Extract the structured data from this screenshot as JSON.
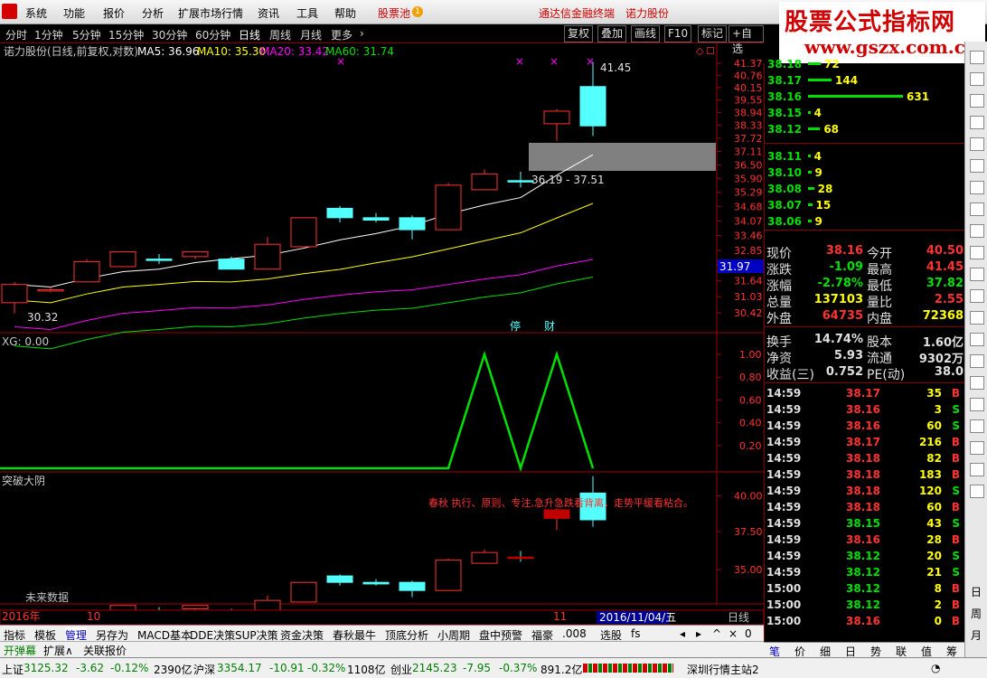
{
  "menubar": {
    "items": [
      "系统",
      "功能",
      "报价",
      "分析",
      "扩展市场行情",
      "资讯",
      "工具",
      "帮助"
    ],
    "stock_pool": "股票池",
    "stock_pool_badge": "1",
    "promo": "通达信金融终端",
    "stock_name": "诺力股份"
  },
  "banner": {
    "line1": "股票公式指标网",
    "line2": "www.gszx.com.cn"
  },
  "periods": [
    "分时",
    "1分钟",
    "5分钟",
    "15分钟",
    "30分钟",
    "60分钟",
    "日线",
    "周线",
    "月线",
    "更多"
  ],
  "period_active": "日线",
  "tool_buttons": [
    "复权",
    "叠加",
    "画线",
    "F10",
    "标记",
    "+自选"
  ],
  "main_chart": {
    "title": "诺力股份(日线,前复权,对数)",
    "ma5": "MA5: 36.96",
    "ma10": "MA10: 35.30",
    "ma20": "MA20: 33.42",
    "ma60": "MA60: 31.74",
    "price_axis": [
      "41.37",
      "40.76",
      "40.15",
      "39.55",
      "38.94",
      "38.33",
      "37.72",
      "37.11",
      "36.50",
      "35.90",
      "35.29",
      "34.68",
      "34.07",
      "33.46",
      "32.85",
      "32.25",
      "31.64",
      "31.03",
      "30.42"
    ],
    "current_price_tag": "31.97",
    "high_label": "41.45",
    "low_label": "30.32",
    "range_label": "36.19 - 37.51",
    "markers": [
      "停",
      "财"
    ],
    "candles": [
      {
        "o": 30.8,
        "c": 31.5,
        "h": 31.6,
        "l": 30.4,
        "up": true
      },
      {
        "o": 31.3,
        "c": 31.3,
        "h": 31.4,
        "l": 31.2,
        "up": true
      },
      {
        "o": 31.6,
        "c": 32.4,
        "h": 32.5,
        "l": 31.6,
        "up": true
      },
      {
        "o": 32.2,
        "c": 32.8,
        "h": 32.8,
        "l": 32.2,
        "up": true
      },
      {
        "o": 32.5,
        "c": 32.5,
        "h": 32.7,
        "l": 32.3,
        "up": false
      },
      {
        "o": 32.6,
        "c": 32.8,
        "h": 32.8,
        "l": 32.5,
        "up": true
      },
      {
        "o": 32.5,
        "c": 32.1,
        "h": 32.6,
        "l": 32.1,
        "up": false
      },
      {
        "o": 32.1,
        "c": 33.1,
        "h": 33.4,
        "l": 32.1,
        "up": true
      },
      {
        "o": 33.0,
        "c": 34.2,
        "h": 34.2,
        "l": 33.0,
        "up": true
      },
      {
        "o": 34.6,
        "c": 34.2,
        "h": 34.7,
        "l": 34.0,
        "up": false
      },
      {
        "o": 34.2,
        "c": 34.1,
        "h": 34.4,
        "l": 34.0,
        "up": false
      },
      {
        "o": 34.2,
        "c": 33.7,
        "h": 34.3,
        "l": 33.3,
        "up": false
      },
      {
        "o": 33.7,
        "c": 35.6,
        "h": 35.7,
        "l": 33.7,
        "up": true
      },
      {
        "o": 35.4,
        "c": 36.1,
        "h": 36.3,
        "l": 35.4,
        "up": true
      },
      {
        "o": 35.8,
        "c": 35.8,
        "h": 36.2,
        "l": 35.5,
        "up": false
      },
      {
        "o": 38.4,
        "c": 39.0,
        "h": 39.1,
        "l": 37.6,
        "up": true
      },
      {
        "o": 40.2,
        "c": 38.3,
        "h": 41.45,
        "l": 37.82,
        "up": false
      }
    ]
  },
  "xg_panel": {
    "title": "XG: 0.00",
    "axis": [
      "1.00",
      "0.80",
      "0.60",
      "0.40",
      "0.20"
    ]
  },
  "sub_panel": {
    "title": "突破大阴",
    "note": "春秋 执行、原则、专注,急升急跌看背离，走势平缓看粘合。",
    "axis": [
      "40.00",
      "37.50",
      "35.00"
    ],
    "future_label": "未来数据"
  },
  "date_axis": {
    "d1": "2016年",
    "d2": "10",
    "d3": "11",
    "cursor": "2016/11/04/五",
    "period": "日线"
  },
  "indicator_tabs": [
    "指标",
    "模板",
    "管理",
    "另存为",
    "MACD基本",
    "DDE决策",
    "SUP决策",
    "资金决策",
    "春秋最牛",
    "顶底分析",
    "小周期",
    "盘中预警",
    "福豪",
    ".008",
    "选股",
    "fs"
  ],
  "indicator_active": "管理",
  "sub_tabs": [
    "开弹幕",
    "扩展∧",
    "关联报价"
  ],
  "order_book": {
    "asks": [
      {
        "p": "38.18",
        "v": "72"
      },
      {
        "p": "38.17",
        "v": "144"
      },
      {
        "p": "38.16",
        "v": "631"
      },
      {
        "p": "38.15",
        "v": "4"
      },
      {
        "p": "38.12",
        "v": "68"
      }
    ],
    "bids": [
      {
        "p": "38.11",
        "v": "4"
      },
      {
        "p": "38.10",
        "v": "9"
      },
      {
        "p": "38.08",
        "v": "28"
      },
      {
        "p": "38.07",
        "v": "15"
      },
      {
        "p": "38.06",
        "v": "9"
      }
    ]
  },
  "quote": [
    {
      "l1": "现价",
      "v1": "38.16",
      "l2": "今开",
      "v2": "40.50"
    },
    {
      "l1": "涨跌",
      "v1": "-1.09",
      "l2": "最高",
      "v2": "41.45"
    },
    {
      "l1": "涨幅",
      "v1": "-2.78%",
      "l2": "最低",
      "v2": "37.82"
    },
    {
      "l1": "总量",
      "v1": "137103",
      "l2": "量比",
      "v2": "2.55"
    },
    {
      "l1": "外盘",
      "v1": "64735",
      "l2": "内盘",
      "v2": "72368"
    }
  ],
  "fundamentals": [
    {
      "l1": "换手",
      "v1": "14.74%",
      "l2": "股本",
      "v2": "1.60亿"
    },
    {
      "l1": "净资",
      "v1": "5.93",
      "l2": "流通",
      "v2": "9302万"
    },
    {
      "l1": "收益(三)",
      "v1": "0.752",
      "l2": "PE(动)",
      "v2": "38.0"
    }
  ],
  "ticks": [
    {
      "t": "14:59",
      "p": "38.17",
      "v": "35",
      "s": "B"
    },
    {
      "t": "14:59",
      "p": "38.16",
      "v": "3",
      "s": "S"
    },
    {
      "t": "14:59",
      "p": "38.16",
      "v": "60",
      "s": "S"
    },
    {
      "t": "14:59",
      "p": "38.17",
      "v": "216",
      "s": "B"
    },
    {
      "t": "14:59",
      "p": "38.18",
      "v": "82",
      "s": "B"
    },
    {
      "t": "14:59",
      "p": "38.18",
      "v": "183",
      "s": "B"
    },
    {
      "t": "14:59",
      "p": "38.18",
      "v": "120",
      "s": "S"
    },
    {
      "t": "14:59",
      "p": "38.18",
      "v": "60",
      "s": "B"
    },
    {
      "t": "14:59",
      "p": "38.15",
      "v": "43",
      "s": "S"
    },
    {
      "t": "14:59",
      "p": "38.16",
      "v": "28",
      "s": "B"
    },
    {
      "t": "14:59",
      "p": "38.12",
      "v": "20",
      "s": "S"
    },
    {
      "t": "14:59",
      "p": "38.12",
      "v": "21",
      "s": "S"
    },
    {
      "t": "15:00",
      "p": "38.12",
      "v": "8",
      "s": "B"
    },
    {
      "t": "15:00",
      "p": "38.12",
      "v": "2",
      "s": "B"
    },
    {
      "t": "15:00",
      "p": "38.16",
      "v": "0",
      "s": "B"
    }
  ],
  "right_tabs": [
    "笔",
    "价",
    "细",
    "日",
    "势",
    "联",
    "值",
    "筹"
  ],
  "sidebar_text": [
    "日",
    "周",
    "月"
  ],
  "status": {
    "sh_label": "上证",
    "sh_val": "3125.32",
    "sh_chg": "-3.62",
    "sh_pct": "-0.12%",
    "sh_amt": "2390亿",
    "sz_label": "沪深",
    "sz_val": "3354.17",
    "sz_chg": "-10.91",
    "sz_pct": "-0.32%",
    "sz_amt": "1108亿",
    "cy_label": "创业",
    "cy_val": "2145.23",
    "cy_chg": "-7.95",
    "cy_pct": "-0.37%",
    "cy_amt": "891.2亿",
    "server": "深圳行情主站2"
  },
  "colors": {
    "up": "#ff3232",
    "down": "#54ffff",
    "ma5": "#ffffff",
    "ma10": "#ffff00",
    "ma20": "#ff00ff",
    "ma60": "#00e000",
    "xg": "#00e000"
  }
}
